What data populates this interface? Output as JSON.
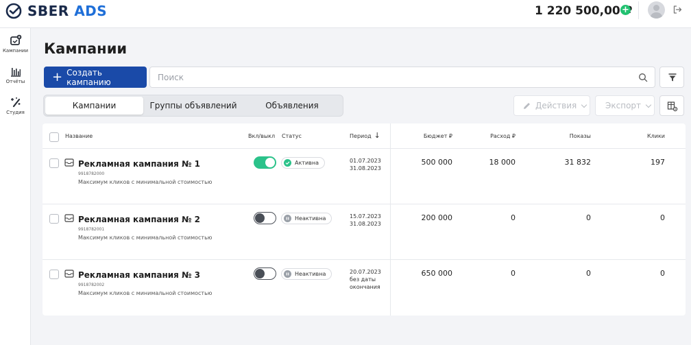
{
  "header": {
    "logo_main": "SBER",
    "logo_accent": "ADS",
    "balance": "1 220 500,00 ₽"
  },
  "sidebar": {
    "items": [
      {
        "label": "Кампании",
        "icon": "campaign-add-icon"
      },
      {
        "label": "Отчёты",
        "icon": "bar-chart-icon"
      },
      {
        "label": "Студия",
        "icon": "magic-wand-icon"
      }
    ]
  },
  "page": {
    "title": "Кампании",
    "create_label": "Создать кампанию",
    "search_placeholder": "Поиск",
    "tabs": [
      "Кампании",
      "Группы объявлений",
      "Объявления"
    ],
    "actions_label": "Действия",
    "export_label": "Экспорт"
  },
  "table": {
    "headers": {
      "name": "Название",
      "toggle": "Вкл/выкл",
      "status": "Статус",
      "period": "Период",
      "budget": "Бюджет ₽",
      "spend": "Расход ₽",
      "impressions": "Показы",
      "clicks": "Клики"
    },
    "rows": [
      {
        "name": "Рекламная кампания № 1",
        "id": "9918782000",
        "strategy": "Максимум кликов с минимальной стоимостью",
        "enabled": true,
        "status": "Активна",
        "period_start": "01.07.2023",
        "period_end": "31.08.2023",
        "period_extra": "",
        "budget": "500 000",
        "spend": "18 000",
        "impressions": "31 832",
        "clicks": "197"
      },
      {
        "name": "Рекламная кампания № 2",
        "id": "9918782001",
        "strategy": "Максимум кликов с минимальной стоимостью",
        "enabled": false,
        "status": "Неактивна",
        "period_start": "15.07.2023",
        "period_end": "31.08.2023",
        "period_extra": "",
        "budget": "200 000",
        "spend": "0",
        "impressions": "0",
        "clicks": "0"
      },
      {
        "name": "Рекламная кампания № 3",
        "id": "9918782002",
        "strategy": "Максимум кликов с минимальной стоимостью",
        "enabled": false,
        "status": "Неактивна",
        "period_start": "20.07.2023",
        "period_end": "без даты",
        "period_extra": "окончания",
        "budget": "650 000",
        "spend": "0",
        "impressions": "0",
        "clicks": "0"
      }
    ]
  },
  "colors": {
    "primary": "#1a4aa8",
    "brand_blue": "#1f6fd8",
    "active_green": "#2bc28a",
    "balance_plus": "#21c170"
  }
}
